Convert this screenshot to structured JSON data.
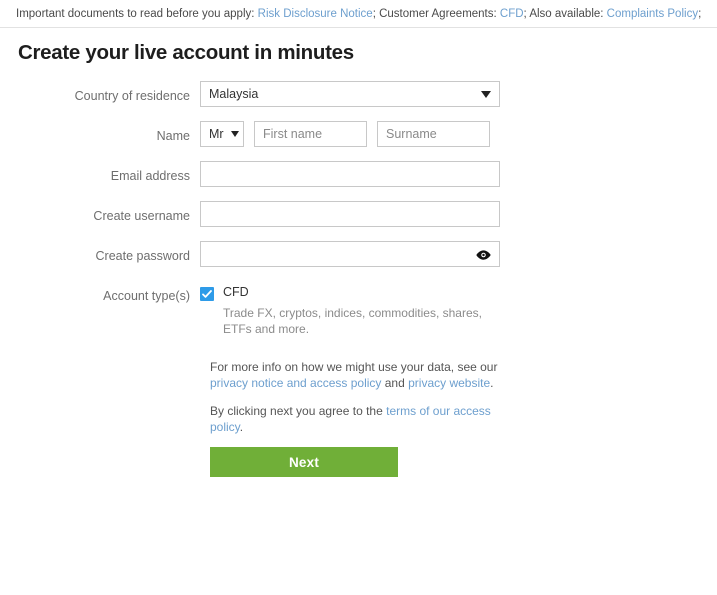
{
  "topbar": {
    "intro": "Important documents to read before you apply:",
    "link_risk": "Risk Disclosure Notice",
    "sep1": ";",
    "agreements_label": "Customer Agreements:",
    "link_cfd": "CFD",
    "sep2": ";",
    "also_label": "Also available:",
    "link_complaints": "Complaints Policy",
    "sep3": ";"
  },
  "heading": "Create your live account in minutes",
  "form": {
    "country": {
      "label": "Country of residence",
      "value": "Malaysia",
      "caret": "chevron-down-icon"
    },
    "name": {
      "label": "Name",
      "title_value": "Mr",
      "first_placeholder": "First name",
      "first_value": "",
      "surname_placeholder": "Surname",
      "surname_value": ""
    },
    "email": {
      "label": "Email address",
      "placeholder": "",
      "value": ""
    },
    "username": {
      "label": "Create username",
      "placeholder": "",
      "value": ""
    },
    "password": {
      "label": "Create password",
      "placeholder": "",
      "value": "",
      "reveal_icon": "eye-icon"
    },
    "account_types": {
      "label": "Account type(s)",
      "options": [
        {
          "name": "CFD",
          "description": "Trade FX, cryptos, indices, commodities, shares, ETFs and more.",
          "checked": true
        }
      ]
    }
  },
  "legal": {
    "privacy_pre": "For more info on how we might use your data, see our ",
    "privacy_link_1": "privacy notice and access policy",
    "privacy_mid": " and ",
    "privacy_link_2": "privacy website",
    "privacy_end": ".",
    "terms_pre": "By clicking next you agree to the ",
    "terms_link": "terms of our access policy",
    "terms_end": "."
  },
  "actions": {
    "next_label": "Next"
  },
  "colors": {
    "accent_green": "#70af38",
    "checkbox_blue": "#2e9be8",
    "link_blue": "#6d9fce",
    "label_grey": "#6e6e6e",
    "border_grey": "#c8c8c8"
  }
}
